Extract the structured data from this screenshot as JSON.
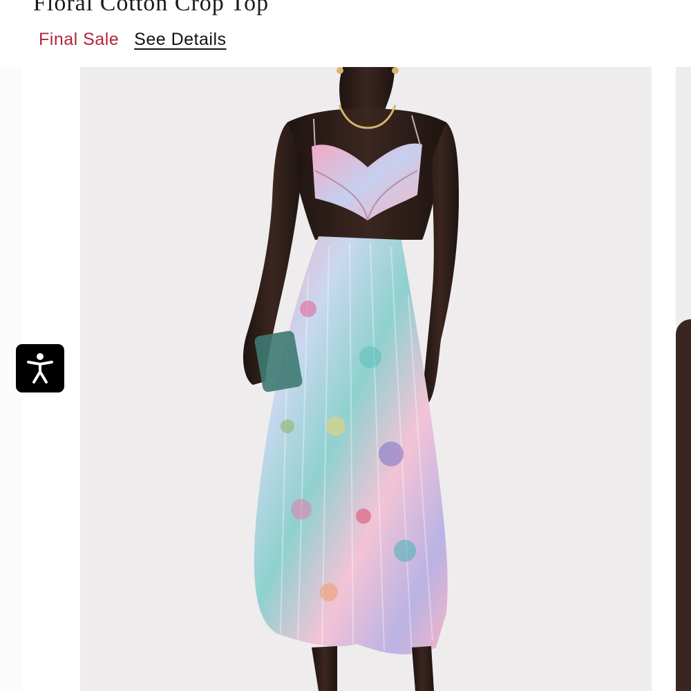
{
  "product": {
    "title": "Floral Cotton Crop Top",
    "final_sale_label": "Final Sale",
    "see_details_label": "See Details"
  },
  "gallery": {
    "main_image_alt": "Model wearing floral cotton crop top with matching pleated maxi skirt",
    "background_color": "#efeced"
  },
  "accessibility": {
    "icon": "accessibility-person-icon"
  },
  "colors": {
    "sale_red": "#b1243a",
    "text_dark": "#1a1a1a",
    "accessibility_bg": "#000000"
  }
}
